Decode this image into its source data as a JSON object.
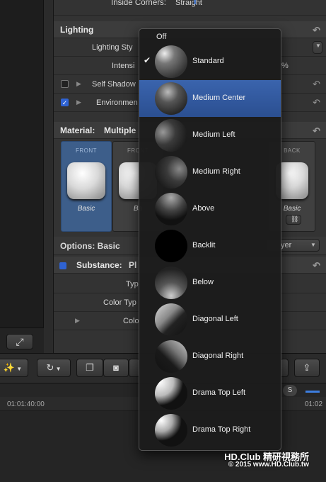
{
  "inspector": {
    "inside_corners_label": "Inside Corners:",
    "inside_corners_value": "Straight",
    "lighting_header": "Lighting",
    "lighting_style_label": "Lighting Sty",
    "intensity_label": "Intensi",
    "intensity_suffix": "%",
    "self_shadows_label": "Self Shadow",
    "environment_label": "Environmen",
    "material_header": "Material:",
    "material_value": "Multiple",
    "tiles": [
      {
        "caption": "FRONT",
        "name": "Basic"
      },
      {
        "caption": "FRONT",
        "name": "Ba"
      },
      {
        "caption": "BACK",
        "name": "Basic"
      }
    ],
    "options_label": "Options: Basic",
    "options_dropdown": "yer",
    "substance_label": "Substance:",
    "substance_value": "Pl",
    "type_label": "Typ",
    "color_type_label": "Color Typ",
    "color_label": "Colo"
  },
  "timeline": {
    "timecode_left": "01:01:40:00",
    "timecode_right": "01:02"
  },
  "menu": {
    "off_label": "Off",
    "items": [
      {
        "label": "Standard",
        "checked": true,
        "selected": false
      },
      {
        "label": "Medium Center",
        "checked": false,
        "selected": true
      },
      {
        "label": "Medium Left",
        "checked": false,
        "selected": false
      },
      {
        "label": "Medium Right",
        "checked": false,
        "selected": false
      },
      {
        "label": "Above",
        "checked": false,
        "selected": false
      },
      {
        "label": "Backlit",
        "checked": false,
        "selected": false
      },
      {
        "label": "Below",
        "checked": false,
        "selected": false
      },
      {
        "label": "Diagonal Left",
        "checked": false,
        "selected": false
      },
      {
        "label": "Diagonal Right",
        "checked": false,
        "selected": false
      },
      {
        "label": "Drama Top Left",
        "checked": false,
        "selected": false
      },
      {
        "label": "Drama Top Right",
        "checked": false,
        "selected": false
      }
    ],
    "check_glyph": "✔"
  },
  "watermark": {
    "line1": "HD.Club 精研視務所",
    "line2": "© 2015  www.HD.Club.tw"
  },
  "colors": {
    "selection": "#2f5aa0",
    "accent_blue": "#2f63d3"
  }
}
